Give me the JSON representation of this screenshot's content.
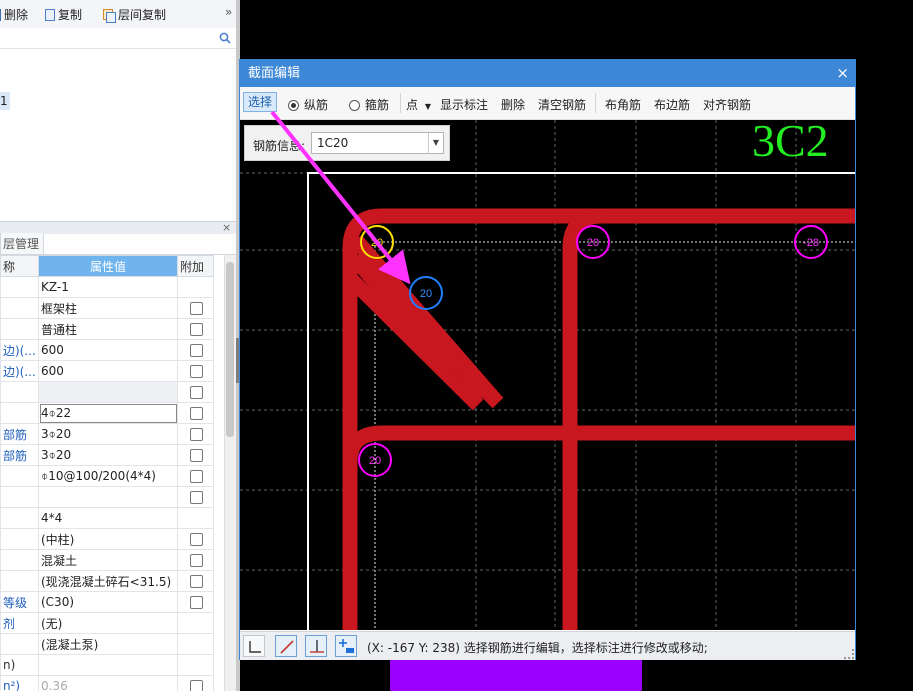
{
  "left_toolbar": {
    "delete_label": "删除",
    "copy_label": "复制",
    "floor_copy_label": "层间复制",
    "more_glyph": "»"
  },
  "tree": {
    "item_1": "1"
  },
  "prop_panel": {
    "tab_label": "层管理",
    "close_glyph": "×",
    "columns": {
      "name": "称",
      "value": "属性值",
      "extra": "附加"
    },
    "rows": [
      {
        "name": "",
        "name_blue": false,
        "value": "KZ-1",
        "checkbox": false,
        "grey": false
      },
      {
        "name": "",
        "name_blue": false,
        "value": "框架柱",
        "checkbox": true,
        "grey": false
      },
      {
        "name": "",
        "name_blue": false,
        "value": "普通柱",
        "checkbox": true,
        "grey": false
      },
      {
        "name": "边)(...",
        "name_blue": true,
        "value": "600",
        "checkbox": true,
        "grey": false
      },
      {
        "name": "边)(...",
        "name_blue": true,
        "value": "600",
        "checkbox": true,
        "grey": false
      },
      {
        "name": "",
        "name_blue": false,
        "value": "",
        "checkbox": true,
        "grey": true
      },
      {
        "name": "",
        "name_blue": false,
        "value": "4⌽22",
        "checkbox": true,
        "grey": false,
        "selected": true
      },
      {
        "name": "部筋",
        "name_blue": true,
        "value": "3⌽20",
        "checkbox": true,
        "grey": false
      },
      {
        "name": "部筋",
        "name_blue": true,
        "value": "3⌽20",
        "checkbox": true,
        "grey": false
      },
      {
        "name": "",
        "name_blue": false,
        "value": "⌽10@100/200(4*4)",
        "checkbox": true,
        "grey": false
      },
      {
        "name": "",
        "name_blue": false,
        "value": "",
        "checkbox": true,
        "grey": false
      },
      {
        "name": "",
        "name_blue": false,
        "value": "4*4",
        "checkbox": false,
        "grey": false
      },
      {
        "name": "",
        "name_blue": false,
        "value": "(中柱)",
        "checkbox": true,
        "grey": false
      },
      {
        "name": "",
        "name_blue": false,
        "value": "混凝土",
        "checkbox": true,
        "grey": false
      },
      {
        "name": "",
        "name_blue": false,
        "value": "(现浇混凝土碎石<31.5)",
        "checkbox": true,
        "grey": false
      },
      {
        "name": "等级",
        "name_blue": true,
        "value": "(C30)",
        "checkbox": true,
        "grey": false
      },
      {
        "name": "剂",
        "name_blue": true,
        "value": "(无)",
        "checkbox": false,
        "grey": false
      },
      {
        "name": "",
        "name_blue": false,
        "value": "(混凝土泵)",
        "checkbox": false,
        "grey": false
      },
      {
        "name": "n)",
        "name_blue": false,
        "value": "",
        "checkbox": false,
        "grey": false
      },
      {
        "name": "n²)",
        "name_blue": true,
        "value": "0.36",
        "checkbox": true,
        "grey": false,
        "disabled": true
      }
    ]
  },
  "dialog": {
    "title": "截面编辑",
    "close_glyph": "×",
    "toolbar": {
      "select": "选择",
      "longitudinal": "纵筋",
      "stirrup": "箍筋",
      "point": "点",
      "show_label": "显示标注",
      "delete": "删除",
      "clear": "清空钢筋",
      "corner": "布角筋",
      "edge": "布边筋",
      "align": "对齐钢筋"
    },
    "rebar_info": {
      "label": "钢筋信息:",
      "value": "1C20"
    },
    "canvas": {
      "big_label": "3C2",
      "bar_labels": [
        "20",
        "20",
        "-28",
        "20",
        "20"
      ],
      "colors": {
        "stirrup": "#c8171f",
        "frame": "#ffffff",
        "yellow": "#ffe100",
        "magenta": "#ff00ff",
        "blue": "#1e7fff",
        "green": "#22ee22",
        "arrow": "#ff33ff"
      }
    },
    "status": "(X: -167 Y: 238) 选择钢筋进行编辑，选择标注进行修改或移动;"
  }
}
